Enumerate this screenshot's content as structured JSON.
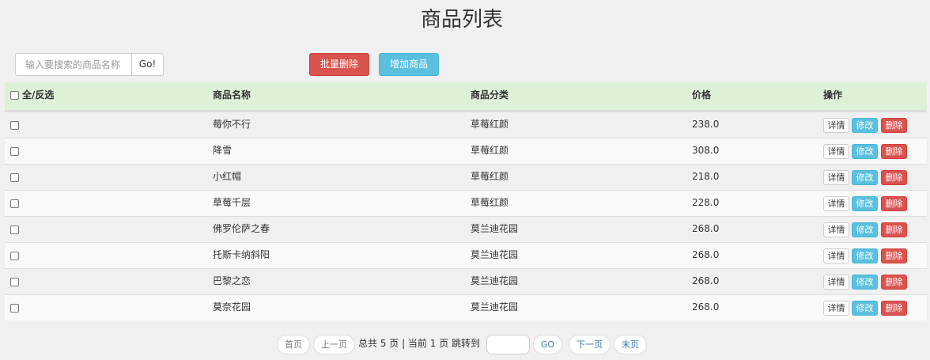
{
  "page": {
    "title": "商品列表"
  },
  "toolbar": {
    "search_placeholder": "输入要搜索的商品名称",
    "go_label": "Go!",
    "batch_delete_label": "批量删除",
    "add_label": "增加商品"
  },
  "table": {
    "headers": {
      "select_all": "全/反选",
      "name": "商品名称",
      "category": "商品分类",
      "price": "价格",
      "actions": "操作"
    },
    "action_labels": {
      "detail": "详情",
      "edit": "修改",
      "delete": "删除"
    },
    "rows": [
      {
        "name": "莓你不行",
        "category": "草莓红颜",
        "price": "238.0"
      },
      {
        "name": "降雪",
        "category": "草莓红颜",
        "price": "308.0"
      },
      {
        "name": "小红帽",
        "category": "草莓红颜",
        "price": "218.0"
      },
      {
        "name": "草莓千层",
        "category": "草莓红颜",
        "price": "228.0"
      },
      {
        "name": "佛罗伦萨之春",
        "category": "莫兰迪花园",
        "price": "268.0"
      },
      {
        "name": "托斯卡纳斜阳",
        "category": "莫兰迪花园",
        "price": "268.0"
      },
      {
        "name": "巴黎之恋",
        "category": "莫兰迪花园",
        "price": "268.0"
      },
      {
        "name": "莫奈花园",
        "category": "莫兰迪花园",
        "price": "268.0"
      }
    ]
  },
  "pagination": {
    "first": "首页",
    "prev": "上一页",
    "info": "总共 5 页 | 当前 1 页 跳转到",
    "go": "GO",
    "next": "下一页",
    "last": "末页",
    "total_pages": 5,
    "current_page": 1
  },
  "colors": {
    "header_bg": "#dff0d8",
    "danger": "#d9534f",
    "info": "#5bc0de",
    "link": "#337ab7"
  }
}
